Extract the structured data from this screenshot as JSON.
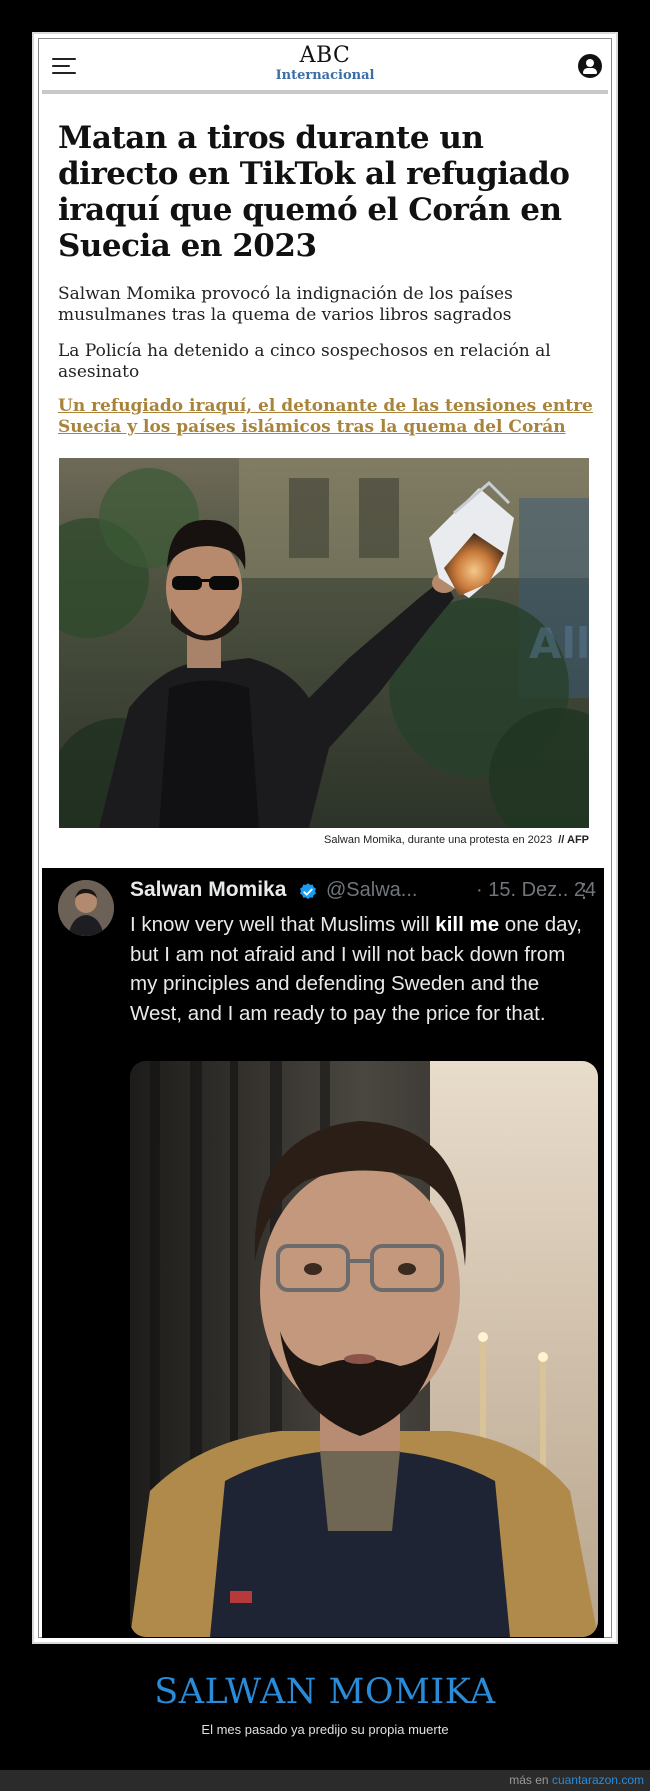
{
  "header": {
    "brand": "ABC",
    "section": "Internacional"
  },
  "article": {
    "headline": "Matan a tiros durante un directo en TikTok al refugiado iraquí que quemó el Corán en Suecia en 2023",
    "subheads": [
      "Salwan Momika provocó la indignación de los países musulmanes tras la quema de varios libros sagrados",
      "La Policía ha detenido a cinco sospechosos en relación al asesinato"
    ],
    "related_link": "Un refugiado iraquí, el detonante de las tensiones entre Suecia y los países islámicos tras la quema del Corán",
    "photo_caption": "Salwan Momika, durante una protesta en 2023",
    "photo_credit": "// AFP"
  },
  "tweet": {
    "name": "Salwan Momika",
    "handle": "@Salwa...",
    "date": "· 15. Dez.. 24",
    "more": "⋮",
    "text_before": "I know very well that Muslims will ",
    "text_bold": "kill me",
    "text_after": " one day, but I am not afraid and I will not back down from my principles and defending Sweden and the West, and I am ready to pay the price for that."
  },
  "footer": {
    "title": "SALWAN MOMIKA",
    "subtitle": "El mes pasado ya predijo su propia muerte",
    "credit_prefix": "más en ",
    "credit_site": "cuantarazon.com"
  },
  "colors": {
    "abc_blue": "#3b6ea5",
    "link_gold": "#a8843a",
    "footer_blue": "#2a8bd8",
    "verified_blue": "#1d9bf0"
  }
}
